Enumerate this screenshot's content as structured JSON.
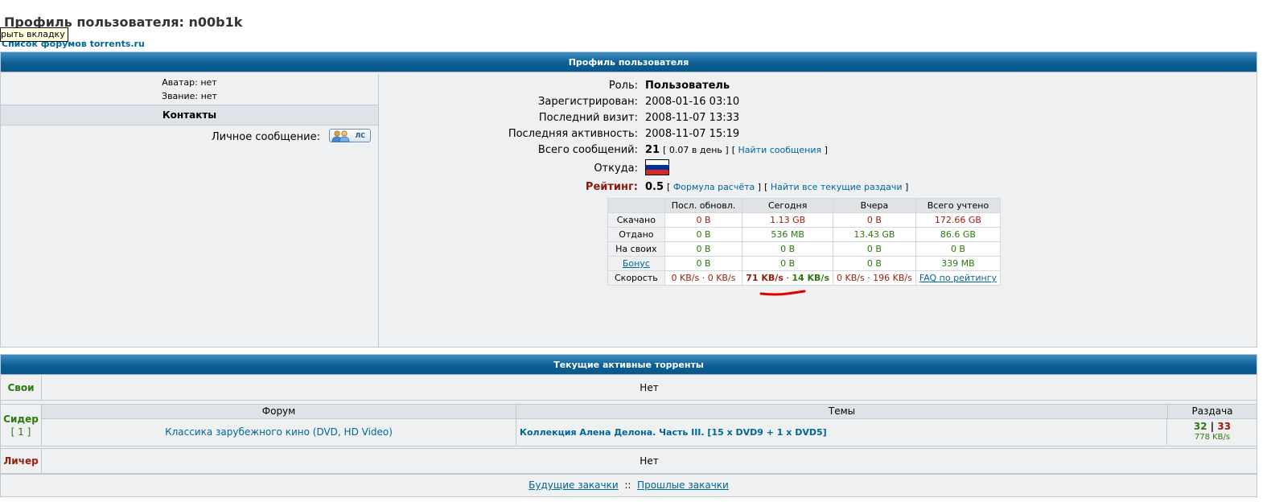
{
  "page": {
    "title": "Профиль пользователя: n00b1k",
    "tooltip": "рыть вкладку",
    "forum_index_link": "Список форумов torrents.ru"
  },
  "profile": {
    "header": "Профиль пользователя",
    "avatar_text": "Аватар: нет",
    "rank_text": "Звание: нет",
    "contacts_header": "Контакты",
    "pm_label": "Личное сообщение:",
    "pm_button_text": "ЛС",
    "fields": {
      "role_label": "Роль:",
      "role_value": "Пользователь",
      "registered_label": "Зарегистрирован:",
      "registered_value": "2008-01-16 03:10",
      "last_visit_label": "Последний визит:",
      "last_visit_value": "2008-11-07 13:33",
      "last_activity_label": "Последняя активность:",
      "last_activity_value": "2008-11-07 15:19",
      "posts_label": "Всего сообщений:",
      "posts_value": "21",
      "posts_per_day": "0.07 в день",
      "find_posts_link": "Найти сообщения",
      "from_label": "Откуда:",
      "rating_label": "Рейтинг:",
      "rating_value": "0.5",
      "rating_formula_link": "Формула расчёта",
      "find_seeding_link": "Найти все текущие раздачи"
    },
    "flag_colors": [
      "#ffffff",
      "#0033a0",
      "#d52b1e"
    ],
    "stats": {
      "headers": [
        "",
        "Посл. обновл.",
        "Сегодня",
        "Вчера",
        "Всего учтено"
      ],
      "rows": [
        {
          "label": "Скачано",
          "cells": [
            "0 B",
            "1.13 GB",
            "0 B",
            "172.66 GB"
          ]
        },
        {
          "label": "Отдано",
          "cells": [
            "0 B",
            "536 MB",
            "13.43 GB",
            "86.6 GB"
          ]
        },
        {
          "label": "На своих",
          "cells": [
            "0 B",
            "0 B",
            "0 B",
            "0 B"
          ]
        },
        {
          "label": "Бонус",
          "cells": [
            "0 B",
            "0 B",
            "0 B",
            "339 MB"
          ]
        }
      ],
      "speed_label": "Скорость",
      "speed_last": "0 KB/s · 0 KB/s",
      "speed_today_down": "71 KB/s",
      "speed_today_sep": " · ",
      "speed_today_up": "14 KB/s",
      "speed_yesterday": "0 KB/s · 196 KB/s",
      "faq_link": "FAQ по рейтингу"
    }
  },
  "torrents": {
    "header": "Текущие активные торренты",
    "own_label": "Свои",
    "own_value": "Нет",
    "seeder_label": "Сидер",
    "seeder_count": "[ 1 ]",
    "columns": [
      "Форум",
      "Темы",
      "Раздача"
    ],
    "seeding_row": {
      "forum": "Классика зарубежного кино (DVD, HD Video)",
      "topic": "Коллекция Алена Делона. Часть III. [15 x DVD9 + 1 x DVD5]",
      "seeders": "32",
      "sep": " | ",
      "leechers": "33",
      "speed": "778 KB/s"
    },
    "leecher_label": "Личер",
    "leecher_value": "Нет",
    "future_link": "Будущие закачки",
    "footer_sep": "::",
    "past_link": "Прошлые закачки"
  }
}
